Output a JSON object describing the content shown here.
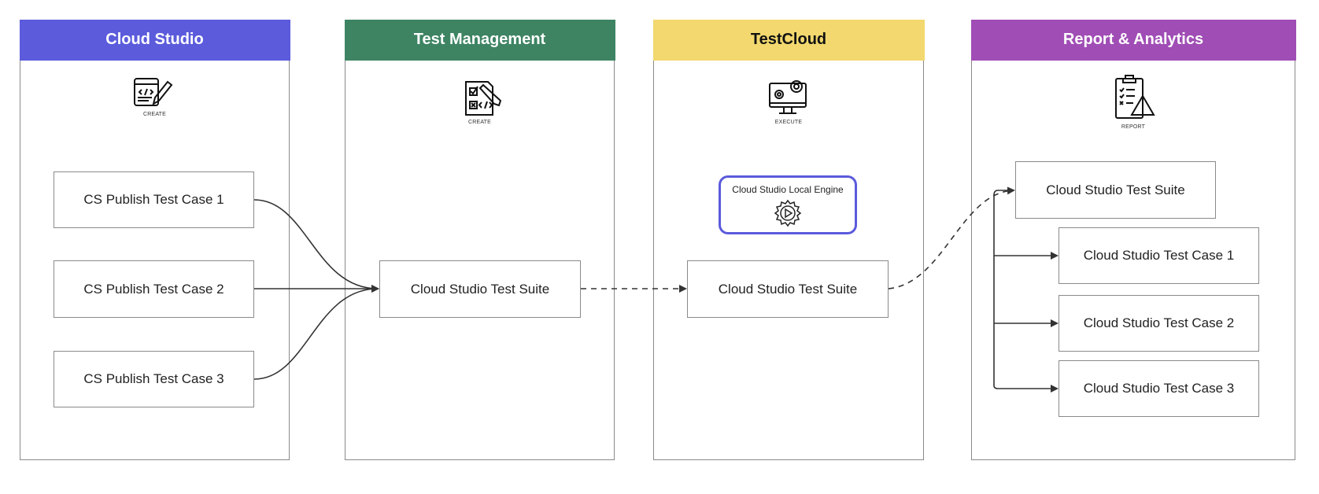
{
  "columns": [
    {
      "title": "Cloud Studio",
      "color": "#5b5bdc",
      "text_color": "#ffffff",
      "icon": "code-window-pencil-icon",
      "icon_label": "CREATE"
    },
    {
      "title": "Test Management",
      "color": "#3e8463",
      "text_color": "#ffffff",
      "icon": "checklist-code-pencil-icon",
      "icon_label": "CREATE"
    },
    {
      "title": "TestCloud",
      "color": "#f2d86e",
      "text_color": "#111111",
      "icon": "monitor-gears-icon",
      "icon_label": "EXECUTE"
    },
    {
      "title": "Report & Analytics",
      "color": "#a04db5",
      "text_color": "#ffffff",
      "icon": "clipboard-warning-icon",
      "icon_label": "REPORT"
    }
  ],
  "cloud_studio": {
    "cases": [
      "CS Publish Test Case 1",
      "CS Publish Test Case 2",
      "CS Publish Test Case 3"
    ]
  },
  "test_management": {
    "suite": "Cloud Studio Test Suite"
  },
  "testcloud": {
    "engine": {
      "label": "Cloud Studio Local Engine",
      "icon": "gear-play-icon",
      "border_color": "#5b5bdc"
    },
    "suite": "Cloud Studio Test Suite"
  },
  "report": {
    "suite": "Cloud Studio Test Suite",
    "cases": [
      "Cloud Studio Test Case 1",
      "Cloud Studio Test Case 2",
      "Cloud Studio Test Case 3"
    ]
  }
}
